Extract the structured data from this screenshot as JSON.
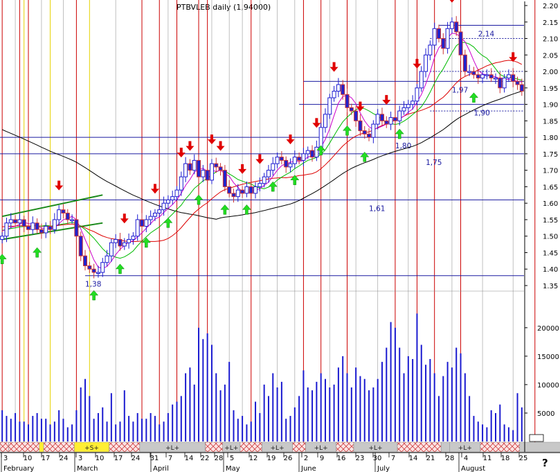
{
  "chart_data": {
    "type": "candlestick",
    "header": "PTBVLEB daily (1,94000)",
    "price_axis": {
      "min": 1.35,
      "max": 2.2,
      "ticks": [
        "1.35",
        "1.40",
        "1.45",
        "1.50",
        "1.55",
        "1.60",
        "1.65",
        "1.70",
        "1.75",
        "1.80",
        "1.85",
        "1.90",
        "1.95",
        "2.00",
        "2.05",
        "2.10",
        "2.15",
        "2.20"
      ]
    },
    "volume_axis": {
      "min": 0,
      "max": 24000,
      "ticks": [
        "5000",
        "10000",
        "15000",
        "20000"
      ]
    },
    "x_day_labels": [
      "3",
      "10",
      "17",
      "24",
      "3",
      "10",
      "17",
      "24",
      "31",
      "7",
      "14",
      "22",
      "28",
      "5",
      "12",
      "19",
      "26",
      "2",
      "9",
      "16",
      "23",
      "30",
      "7",
      "14",
      "21",
      "28",
      "4",
      "11",
      "18",
      "25"
    ],
    "month_labels": [
      "February",
      "March",
      "April",
      "May",
      "June",
      "July",
      "August"
    ],
    "level_labels": [
      "2,14",
      "1,97",
      "1,90",
      "1,80",
      "1,75",
      "1,61",
      "1,38"
    ],
    "levels": [
      {
        "label": "2,14",
        "value": 2.14
      },
      {
        "label": "1,97",
        "value": 1.97
      },
      {
        "label": "1,90",
        "value": 1.9
      },
      {
        "label": "1,80",
        "value": 1.8
      },
      {
        "label": "1,75",
        "value": 1.75
      },
      {
        "label": "1,61",
        "value": 1.61
      },
      {
        "label": "1,38",
        "value": 1.38
      }
    ],
    "dotted_levels": [
      2.1,
      2.0,
      1.88
    ],
    "trend_lines": [
      {
        "from": [
          0,
          1.56
        ],
        "to": [
          23,
          1.625
        ]
      },
      {
        "from": [
          0,
          1.49
        ],
        "to": [
          23,
          1.54
        ]
      }
    ],
    "signal_bar_labels": [
      "+S+",
      "+L+",
      "+L+",
      "+L+",
      "+L+",
      "+L+",
      "+L+"
    ],
    "signal_segments": [
      {
        "from": 0,
        "to": 2,
        "type": "hatch"
      },
      {
        "from": 2,
        "to": 9,
        "type": "hatch"
      },
      {
        "from": 9,
        "to": 10,
        "type": "yellow"
      },
      {
        "from": 10,
        "to": 17,
        "type": "hatch"
      },
      {
        "from": 17,
        "to": 25,
        "type": "yellow",
        "label": "+S+"
      },
      {
        "from": 25,
        "to": 32,
        "type": "hatch"
      },
      {
        "from": 32,
        "to": 47,
        "type": "gray",
        "label": "+L+"
      },
      {
        "from": 47,
        "to": 51,
        "type": "hatch"
      },
      {
        "from": 51,
        "to": 55,
        "type": "gray",
        "label": "+L+"
      },
      {
        "from": 55,
        "to": 60,
        "type": "hatch"
      },
      {
        "from": 60,
        "to": 67,
        "type": "gray",
        "label": "+L+"
      },
      {
        "from": 67,
        "to": 70,
        "type": "hatch"
      },
      {
        "from": 70,
        "to": 77,
        "type": "gray",
        "label": "+L+"
      },
      {
        "from": 77,
        "to": 81,
        "type": "hatch"
      },
      {
        "from": 81,
        "to": 91,
        "type": "gray",
        "label": "+L+"
      },
      {
        "from": 91,
        "to": 101,
        "type": "hatch"
      },
      {
        "from": 101,
        "to": 103,
        "type": "gray"
      },
      {
        "from": 103,
        "to": 110,
        "type": "gray",
        "label": "+L+"
      },
      {
        "from": 110,
        "to": 119,
        "type": "hatch"
      },
      {
        "from": 119,
        "to": 131,
        "type": "gray"
      },
      {
        "from": 131,
        "to": 140,
        "type": "hatch"
      }
    ],
    "closes": [
      1.5,
      1.54,
      1.55,
      1.54,
      1.55,
      1.53,
      1.52,
      1.54,
      1.52,
      1.51,
      1.53,
      1.52,
      1.55,
      1.58,
      1.57,
      1.55,
      1.55,
      1.5,
      1.44,
      1.41,
      1.4,
      1.39,
      1.39,
      1.42,
      1.44,
      1.48,
      1.49,
      1.47,
      1.48,
      1.49,
      1.5,
      1.55,
      1.53,
      1.55,
      1.56,
      1.57,
      1.58,
      1.6,
      1.61,
      1.62,
      1.64,
      1.68,
      1.72,
      1.7,
      1.73,
      1.68,
      1.7,
      1.67,
      1.72,
      1.71,
      1.7,
      1.65,
      1.63,
      1.62,
      1.64,
      1.63,
      1.65,
      1.63,
      1.65,
      1.66,
      1.68,
      1.7,
      1.72,
      1.74,
      1.73,
      1.71,
      1.72,
      1.74,
      1.73,
      1.75,
      1.76,
      1.74,
      1.77,
      1.83,
      1.87,
      1.92,
      1.94,
      1.96,
      1.93,
      1.89,
      1.88,
      1.85,
      1.82,
      1.81,
      1.8,
      1.84,
      1.87,
      1.85,
      1.84,
      1.86,
      1.85,
      1.88,
      1.89,
      1.9,
      1.91,
      1.95,
      2.0,
      2.05,
      2.08,
      2.13,
      2.1,
      2.07,
      2.13,
      2.15,
      2.12,
      2.05,
      2.0,
      2.0,
      1.99,
      1.98,
      1.99,
      1.99,
      1.98,
      1.98,
      1.95,
      1.98,
      1.99,
      1.97,
      1.96,
      1.94
    ],
    "volumes": [
      5500,
      4500,
      4000,
      5000,
      3500,
      3500,
      3000,
      4500,
      5000,
      4000,
      4000,
      3000,
      3500,
      5500,
      4000,
      2500,
      3000,
      5500,
      9500,
      11000,
      8000,
      4000,
      5000,
      6000,
      3500,
      8500,
      3000,
      3500,
      9000,
      4500,
      3500,
      5000,
      4000,
      4000,
      5000,
      4500,
      3000,
      3500,
      5000,
      6500,
      7000,
      8000,
      12000,
      13000,
      10000,
      20000,
      18000,
      19000,
      17000,
      12000,
      9000,
      10000,
      14000,
      5500,
      4000,
      4500,
      3000,
      3500,
      7000,
      5000,
      10000,
      8000,
      12000,
      9500,
      10500,
      4000,
      4500,
      6000,
      8000,
      12500,
      9500,
      9000,
      10500,
      12000,
      11000,
      9500,
      10000,
      13000,
      15000,
      12000,
      9500,
      13000,
      11500,
      11000,
      9000,
      9500,
      11000,
      14000,
      16500,
      21000,
      20000,
      16500,
      12000,
      15000,
      14500,
      22500,
      17000,
      13500,
      14500,
      12000,
      8000,
      11500,
      14000,
      13000,
      16500,
      15500,
      12000,
      8000,
      4500,
      3500,
      3000,
      2500,
      5500,
      5000,
      6500,
      3000,
      2500,
      2000,
      8500,
      6000
    ],
    "ma_lines": [
      {
        "name": "ma_long",
        "color": "#000000",
        "period": 50,
        "pre_start": 1.83
      },
      {
        "name": "ma_mid",
        "color": "#dd0000",
        "period": 21,
        "pre_start": 1.53
      },
      {
        "name": "ma_fast1",
        "color": "#00bb00",
        "period": 10,
        "pre_start": 1.52
      },
      {
        "name": "ma_fast2",
        "color": "#cc00cc",
        "period": 5,
        "pre_start": 1.52
      }
    ],
    "red_cycle_lines": [
      0,
      4,
      6,
      17,
      32,
      36,
      40,
      45,
      47,
      57,
      69,
      73,
      79,
      90,
      95,
      99,
      105,
      122
    ],
    "yellow_cycle_lines": [
      5,
      11,
      20
    ],
    "gray_cycle_lines": [
      3,
      9,
      14,
      26,
      38,
      48,
      52,
      55,
      59,
      63,
      67,
      75,
      81,
      86,
      93,
      103,
      110,
      117
    ],
    "down_arrows": [
      13,
      28,
      35,
      41,
      43,
      48,
      50,
      55,
      59,
      66,
      72,
      76,
      82,
      88,
      95,
      103,
      117,
      122
    ],
    "up_arrows": [
      0,
      8,
      21,
      27,
      33,
      38,
      45,
      51,
      56,
      62,
      67,
      73,
      79,
      83,
      91,
      108,
      120
    ]
  },
  "misc": {
    "corner_mark": "?"
  }
}
